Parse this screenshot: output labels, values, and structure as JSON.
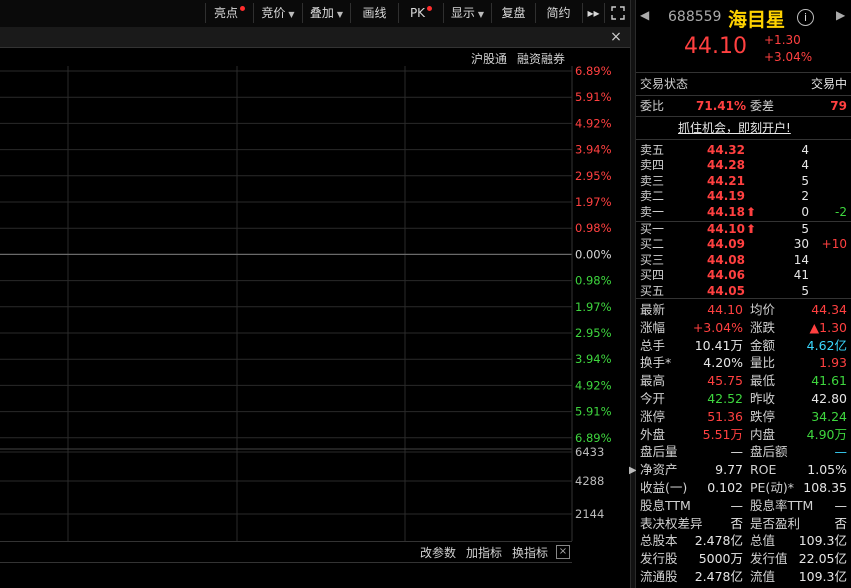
{
  "toolbar": {
    "items": [
      {
        "label": "亮点",
        "dot": true,
        "caret": false
      },
      {
        "label": "竞价",
        "dot": false,
        "caret": true
      },
      {
        "label": "叠加",
        "dot": false,
        "caret": true
      },
      {
        "label": "画线",
        "dot": false,
        "caret": false
      },
      {
        "label": "PK",
        "dot": true,
        "caret": false
      },
      {
        "label": "显示",
        "dot": false,
        "caret": true
      },
      {
        "label": "复盘",
        "dot": false,
        "caret": false
      },
      {
        "label": "简约",
        "dot": false,
        "caret": false
      }
    ],
    "more_label": "▸▸",
    "fullscreen_icon": "fullscreen-icon"
  },
  "chart": {
    "close_label": "×",
    "sub_links": [
      "沪股通",
      "融资融券"
    ],
    "price_ticks": [
      {
        "label": "6.89%",
        "color": "#ff4040"
      },
      {
        "label": "5.91%",
        "color": "#ff4040"
      },
      {
        "label": "4.92%",
        "color": "#ff4040"
      },
      {
        "label": "3.94%",
        "color": "#ff4040"
      },
      {
        "label": "2.95%",
        "color": "#ff4040"
      },
      {
        "label": "1.97%",
        "color": "#ff4040"
      },
      {
        "label": "0.98%",
        "color": "#ff4040"
      },
      {
        "label": "0.00%",
        "color": "#d8d8d8"
      },
      {
        "label": "0.98%",
        "color": "#3ed63e"
      },
      {
        "label": "1.97%",
        "color": "#3ed63e"
      },
      {
        "label": "2.95%",
        "color": "#3ed63e"
      },
      {
        "label": "3.94%",
        "color": "#3ed63e"
      },
      {
        "label": "4.92%",
        "color": "#3ed63e"
      },
      {
        "label": "5.91%",
        "color": "#3ed63e"
      },
      {
        "label": "6.89%",
        "color": "#3ed63e"
      }
    ],
    "volume_ticks": [
      "6433",
      "4288",
      "2144"
    ],
    "bottom_items": [
      "改参数",
      "加指标",
      "换指标"
    ],
    "bottom_close": "×"
  },
  "stock": {
    "code": "688559",
    "name": "海目星",
    "price": "44.10",
    "change": "+1.30",
    "change_pct": "+3.04%",
    "trade_status_label": "交易状态",
    "trade_status": "交易中",
    "weibi_label": "委比",
    "weibi": "71.41%",
    "weicha_label": "委差",
    "weicha": "79",
    "promo": "抓住机会，即刻开户!"
  },
  "order_book": {
    "asks": [
      {
        "label": "卖五",
        "price": "44.32",
        "vol": "4",
        "delta": "",
        "arrow": ""
      },
      {
        "label": "卖四",
        "price": "44.28",
        "vol": "4",
        "delta": "",
        "arrow": ""
      },
      {
        "label": "卖三",
        "price": "44.21",
        "vol": "5",
        "delta": "",
        "arrow": ""
      },
      {
        "label": "卖二",
        "price": "44.19",
        "vol": "2",
        "delta": "",
        "arrow": ""
      },
      {
        "label": "卖一",
        "price": "44.18",
        "vol": "0",
        "delta": "-2",
        "arrow": "⬆"
      }
    ],
    "bids": [
      {
        "label": "买一",
        "price": "44.10",
        "vol": "5",
        "delta": "",
        "arrow": "⬆"
      },
      {
        "label": "买二",
        "price": "44.09",
        "vol": "30",
        "delta": "+10",
        "arrow": ""
      },
      {
        "label": "买三",
        "price": "44.08",
        "vol": "14",
        "delta": "",
        "arrow": ""
      },
      {
        "label": "买四",
        "price": "44.06",
        "vol": "41",
        "delta": "",
        "arrow": ""
      },
      {
        "label": "买五",
        "price": "44.05",
        "vol": "5",
        "delta": "",
        "arrow": ""
      }
    ]
  },
  "stats": [
    {
      "l1": "最新",
      "v1": "44.10",
      "c1": "red",
      "l2": "均价",
      "v2": "44.34",
      "c2": "red"
    },
    {
      "l1": "涨幅",
      "v1": "+3.04%",
      "c1": "red",
      "l2": "涨跌",
      "v2": "▲1.30",
      "c2": "red"
    },
    {
      "l1": "总手",
      "v1": "10.41万",
      "c1": "white",
      "l2": "金额",
      "v2": "4.62亿",
      "c2": "cyan"
    },
    {
      "l1": "换手*",
      "v1": "4.20%",
      "c1": "white",
      "l2": "量比",
      "v2": "1.93",
      "c2": "red"
    },
    {
      "l1": "最高",
      "v1": "45.75",
      "c1": "red",
      "l2": "最低",
      "v2": "41.61",
      "c2": "green"
    },
    {
      "l1": "今开",
      "v1": "42.52",
      "c1": "green",
      "l2": "昨收",
      "v2": "42.80",
      "c2": "white"
    },
    {
      "l1": "涨停",
      "v1": "51.36",
      "c1": "red",
      "l2": "跌停",
      "v2": "34.24",
      "c2": "green"
    },
    {
      "l1": "外盘",
      "v1": "5.51万",
      "c1": "red",
      "l2": "内盘",
      "v2": "4.90万",
      "c2": "green"
    },
    {
      "l1": "盘后量",
      "v1": "—",
      "c1": "white",
      "l2": "盘后额",
      "v2": "—",
      "c2": "cyan"
    },
    {
      "l1": "净资产",
      "v1": "9.77",
      "c1": "white",
      "l2": "ROE",
      "v2": "1.05%",
      "c2": "white"
    },
    {
      "l1": "收益(一)",
      "v1": "0.102",
      "c1": "white",
      "l2": "PE(动)*",
      "v2": "108.35",
      "c2": "white"
    },
    {
      "l1": "股息TTM",
      "v1": "—",
      "c1": "white",
      "l2": "股息率TTM",
      "v2": "—",
      "c2": "white"
    },
    {
      "l1": "表决权差异",
      "v1": "否",
      "c1": "white",
      "l2": "是否盈利",
      "v2": "否",
      "c2": "white"
    },
    {
      "l1": "总股本",
      "v1": "2.478亿",
      "c1": "white",
      "l2": "总值",
      "v2": "109.3亿",
      "c2": "white"
    },
    {
      "l1": "发行股",
      "v1": "5000万",
      "c1": "white",
      "l2": "发行值",
      "v2": "22.05亿",
      "c2": "white"
    },
    {
      "l1": "流通股",
      "v1": "2.478亿",
      "c1": "white",
      "l2": "流值",
      "v2": "109.3亿",
      "c2": "white"
    }
  ],
  "colors": {
    "up": "#ff4040",
    "down": "#3ed63e",
    "flat": "#d8d8d8",
    "accent_yellow": "#ffd200",
    "cyan": "#3ad8ff"
  }
}
